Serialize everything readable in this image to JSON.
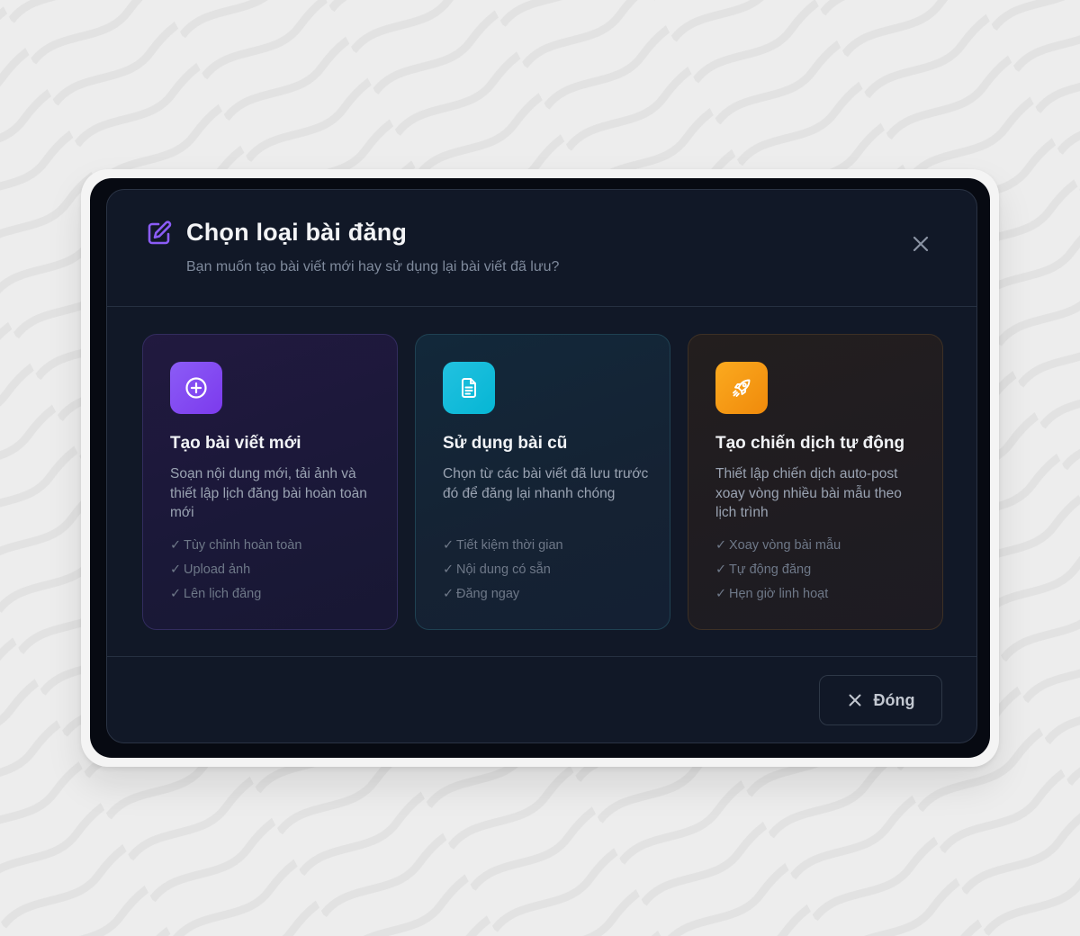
{
  "modal": {
    "title": "Chọn loại bài đăng",
    "subtitle": "Bạn muốn tạo bài viết mới hay sử dụng lại bài viết đã lưu?",
    "header_icon": "edit-icon",
    "close_icon": "close-icon"
  },
  "cards": [
    {
      "title": "Tạo bài viết mới",
      "description": "Soạn nội dung mới, tải ảnh và thiết lập lịch đăng bài hoàn toàn mới",
      "icon": "plus-circle-icon",
      "accent": "#8b5cf6",
      "features": [
        "Tùy chỉnh hoàn toàn",
        "Upload ảnh",
        "Lên lịch đăng"
      ]
    },
    {
      "title": "Sử dụng bài cũ",
      "description": "Chọn từ các bài viết đã lưu trước đó để đăng lại nhanh chóng",
      "icon": "document-icon",
      "accent": "#06b6d4",
      "features": [
        "Tiết kiệm thời gian",
        "Nội dung có sẵn",
        "Đăng ngay"
      ]
    },
    {
      "title": "Tạo chiến dịch tự động",
      "description": "Thiết lập chiến dịch auto-post xoay vòng nhiều bài mẫu theo lịch trình",
      "icon": "rocket-icon",
      "accent": "#f59e0b",
      "features": [
        "Xoay vòng bài mẫu",
        "Tự động đăng",
        "Hẹn giờ linh hoạt"
      ]
    }
  ],
  "check_mark": "✓",
  "footer": {
    "close_label": "Đóng",
    "close_icon": "close-icon"
  },
  "colors": {
    "modal_bg": "#111827",
    "page_bg": "#ececec",
    "header_icon": "#8b5cf6"
  }
}
